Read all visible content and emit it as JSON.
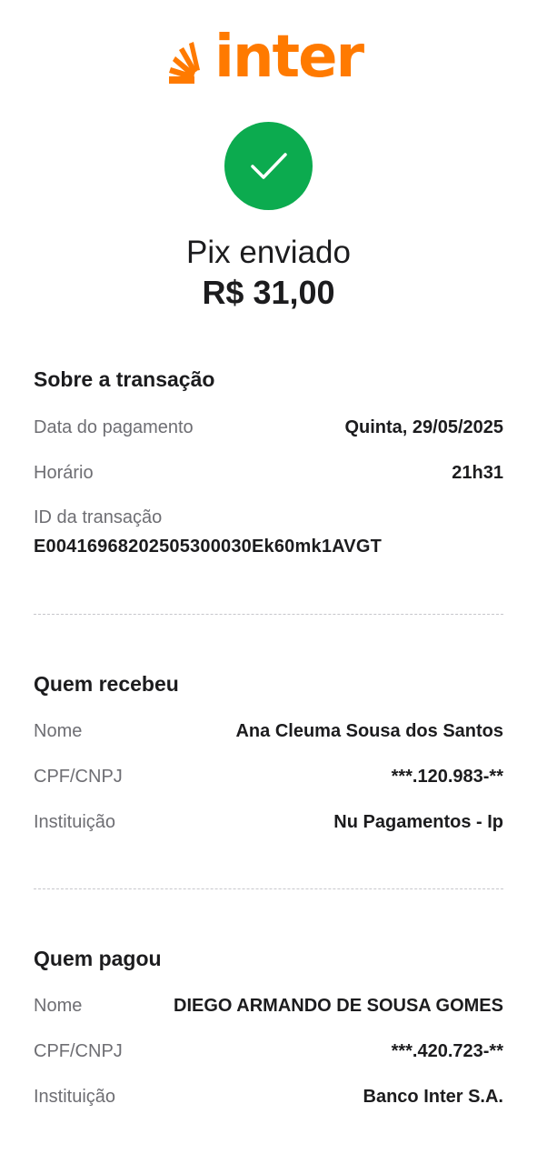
{
  "brand": {
    "name": "inter",
    "color": "#ff7a00"
  },
  "status": {
    "icon": "check-icon",
    "color": "#0cab4f",
    "title": "Pix enviado",
    "amount": "R$ 31,00"
  },
  "transaction": {
    "heading": "Sobre a transação",
    "date_label": "Data do pagamento",
    "date_value": "Quinta, 29/05/2025",
    "time_label": "Horário",
    "time_value": "21h31",
    "id_label": "ID da transação",
    "id_value": "E00416968202505300030Ek60mk1AVGT"
  },
  "receiver": {
    "heading": "Quem recebeu",
    "name_label": "Nome",
    "name_value": "Ana Cleuma Sousa dos Santos",
    "doc_label": "CPF/CNPJ",
    "doc_value": "***.120.983-**",
    "inst_label": "Instituição",
    "inst_value": "Nu Pagamentos - Ip"
  },
  "payer": {
    "heading": "Quem pagou",
    "name_label": "Nome",
    "name_value": "DIEGO ARMANDO DE SOUSA GOMES",
    "doc_label": "CPF/CNPJ",
    "doc_value": "***.420.723-**",
    "inst_label": "Instituição",
    "inst_value": "Banco Inter S.A."
  }
}
